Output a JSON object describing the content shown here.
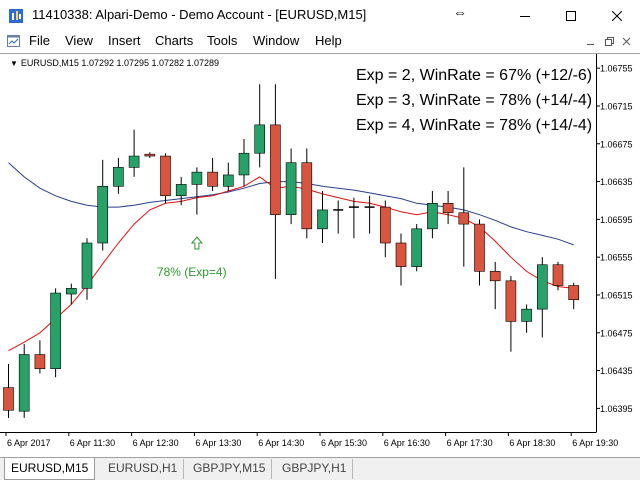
{
  "window": {
    "title": "11410338: Alpari-Demo - Demo Account - [EURUSD,M15]"
  },
  "menu": {
    "items": [
      "File",
      "View",
      "Insert",
      "Charts",
      "Tools",
      "Window",
      "Help"
    ]
  },
  "chart": {
    "symbol_info": "EURUSD,M15  1.07292 1.07295 1.07282 1.07289",
    "stats": [
      "Exp = 2, WinRate = 67% (+12/-6)",
      "Exp = 3, WinRate = 78% (+14/-4)",
      "Exp = 4, WinRate = 78% (+14/-4)"
    ],
    "signal_label": "78% (Exp=4)",
    "colors": {
      "bull": "#26a269",
      "bear": "#d9553f",
      "fast_ma": "#e01010",
      "slow_ma": "#2a3f8f",
      "signal": "#2e9a2e"
    }
  },
  "chart_data": {
    "type": "candlestick",
    "symbol": "EURUSD",
    "timeframe": "M15",
    "ylim": [
      1.0637,
      1.0677
    ],
    "y_ticks": [
      "1.06755",
      "1.06715",
      "1.06675",
      "1.06635",
      "1.06595",
      "1.06555",
      "1.06515",
      "1.06475",
      "1.06435",
      "1.06395"
    ],
    "y_tick_values": [
      1.06755,
      1.06715,
      1.06675,
      1.06635,
      1.06595,
      1.06555,
      1.06515,
      1.06475,
      1.06435,
      1.06395
    ],
    "x_ticks": [
      "6 Apr 2017",
      "6 Apr 11:30",
      "6 Apr 12:30",
      "6 Apr 13:30",
      "6 Apr 14:30",
      "6 Apr 15:30",
      "6 Apr 16:30",
      "6 Apr 17:30",
      "6 Apr 18:30",
      "6 Apr 19:30"
    ],
    "x_tick_index": [
      0,
      4,
      8,
      12,
      16,
      20,
      24,
      28,
      32,
      36
    ],
    "candles": [
      {
        "o": 1.06417,
        "h": 1.06442,
        "l": 1.06385,
        "c": 1.06393
      },
      {
        "o": 1.06392,
        "h": 1.06463,
        "l": 1.06385,
        "c": 1.06452
      },
      {
        "o": 1.06452,
        "h": 1.06467,
        "l": 1.06432,
        "c": 1.06437
      },
      {
        "o": 1.06437,
        "h": 1.06522,
        "l": 1.06428,
        "c": 1.06517
      },
      {
        "o": 1.06516,
        "h": 1.06527,
        "l": 1.06505,
        "c": 1.06522
      },
      {
        "o": 1.06522,
        "h": 1.06575,
        "l": 1.0651,
        "c": 1.0657
      },
      {
        "o": 1.0657,
        "h": 1.06658,
        "l": 1.06562,
        "c": 1.0663
      },
      {
        "o": 1.0663,
        "h": 1.0666,
        "l": 1.06622,
        "c": 1.0665
      },
      {
        "o": 1.0665,
        "h": 1.0669,
        "l": 1.0664,
        "c": 1.06662
      },
      {
        "o": 1.06664,
        "h": 1.06666,
        "l": 1.0666,
        "c": 1.06662
      },
      {
        "o": 1.06662,
        "h": 1.06665,
        "l": 1.06612,
        "c": 1.0662
      },
      {
        "o": 1.0662,
        "h": 1.0664,
        "l": 1.0661,
        "c": 1.06632
      },
      {
        "o": 1.06632,
        "h": 1.0665,
        "l": 1.066,
        "c": 1.06645
      },
      {
        "o": 1.06645,
        "h": 1.0666,
        "l": 1.06625,
        "c": 1.0663
      },
      {
        "o": 1.0663,
        "h": 1.06655,
        "l": 1.06625,
        "c": 1.06642
      },
      {
        "o": 1.06642,
        "h": 1.0668,
        "l": 1.0663,
        "c": 1.06665
      },
      {
        "o": 1.06665,
        "h": 1.06738,
        "l": 1.0665,
        "c": 1.06695
      },
      {
        "o": 1.06695,
        "h": 1.06738,
        "l": 1.06532,
        "c": 1.066
      },
      {
        "o": 1.066,
        "h": 1.0667,
        "l": 1.0659,
        "c": 1.06655
      },
      {
        "o": 1.06655,
        "h": 1.0667,
        "l": 1.06575,
        "c": 1.06585
      },
      {
        "o": 1.06585,
        "h": 1.06625,
        "l": 1.0657,
        "c": 1.06605
      },
      {
        "o": 1.06605,
        "h": 1.06615,
        "l": 1.0658,
        "c": 1.06605
      },
      {
        "o": 1.06608,
        "h": 1.06618,
        "l": 1.06575,
        "c": 1.06608
      },
      {
        "o": 1.06608,
        "h": 1.0662,
        "l": 1.0658,
        "c": 1.06608
      },
      {
        "o": 1.06608,
        "h": 1.06615,
        "l": 1.06555,
        "c": 1.0657
      },
      {
        "o": 1.0657,
        "h": 1.0658,
        "l": 1.06525,
        "c": 1.06545
      },
      {
        "o": 1.06545,
        "h": 1.0659,
        "l": 1.0654,
        "c": 1.06585
      },
      {
        "o": 1.06585,
        "h": 1.06625,
        "l": 1.06575,
        "c": 1.06612
      },
      {
        "o": 1.06612,
        "h": 1.06625,
        "l": 1.0659,
        "c": 1.06602
      },
      {
        "o": 1.06602,
        "h": 1.0665,
        "l": 1.06545,
        "c": 1.0659
      },
      {
        "o": 1.0659,
        "h": 1.06595,
        "l": 1.06525,
        "c": 1.0654
      },
      {
        "o": 1.0654,
        "h": 1.0655,
        "l": 1.065,
        "c": 1.0653
      },
      {
        "o": 1.0653,
        "h": 1.06535,
        "l": 1.06455,
        "c": 1.06487
      },
      {
        "o": 1.06487,
        "h": 1.06505,
        "l": 1.06475,
        "c": 1.065
      },
      {
        "o": 1.065,
        "h": 1.06555,
        "l": 1.0647,
        "c": 1.06547
      },
      {
        "o": 1.06547,
        "h": 1.0655,
        "l": 1.0652,
        "c": 1.06525
      },
      {
        "o": 1.06525,
        "h": 1.06528,
        "l": 1.065,
        "c": 1.0651
      }
    ],
    "series": [
      {
        "name": "fast_ma",
        "values": [
          1.06456,
          1.06465,
          1.06475,
          1.0649,
          1.06505,
          1.06525,
          1.06548,
          1.0657,
          1.0659,
          1.06605,
          1.06612,
          1.06614,
          1.06618,
          1.0662,
          1.06625,
          1.0663,
          1.0664,
          1.06628,
          1.0663,
          1.06627,
          1.06622,
          1.06618,
          1.06614,
          1.06612,
          1.06608,
          1.06603,
          1.066,
          1.06603,
          1.066,
          1.06596,
          1.06587,
          1.06572,
          1.06555,
          1.0654,
          1.0653,
          1.06524,
          1.06522
        ]
      },
      {
        "name": "slow_ma",
        "values": [
          1.06655,
          1.0664,
          1.06628,
          1.0662,
          1.06614,
          1.0661,
          1.06608,
          1.06608,
          1.0661,
          1.06613,
          1.06615,
          1.06617,
          1.06619,
          1.06621,
          1.06624,
          1.06628,
          1.06633,
          1.06635,
          1.06635,
          1.06633,
          1.0663,
          1.06628,
          1.06626,
          1.06623,
          1.0662,
          1.06617,
          1.06612,
          1.0661,
          1.06608,
          1.06605,
          1.066,
          1.06594,
          1.06587,
          1.06582,
          1.06578,
          1.06574,
          1.06568
        ]
      }
    ],
    "signal": {
      "index": 12,
      "price": 1.0657,
      "label": "78% (Exp=4)"
    },
    "grid": false
  },
  "tabs": [
    "EURUSD,M15",
    "EURUSD,H1",
    "GBPJPY,M15",
    "GBPJPY,H1"
  ],
  "active_tab": 0
}
